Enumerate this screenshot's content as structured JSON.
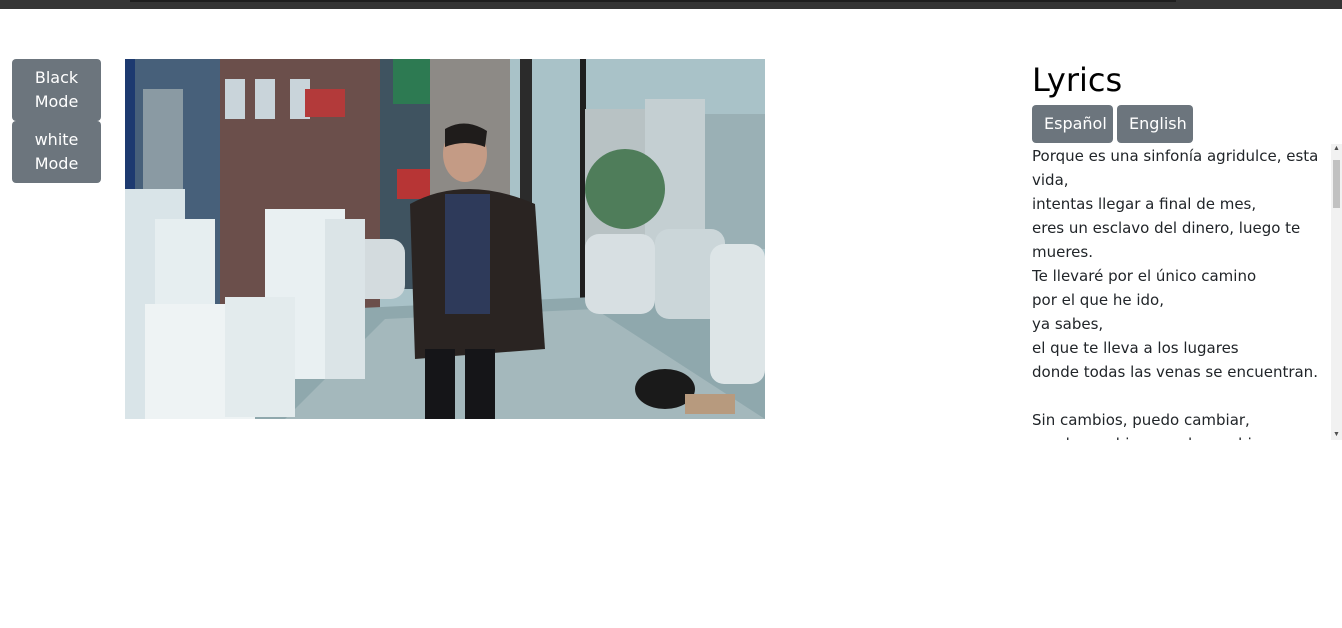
{
  "mode_buttons": {
    "black_label": "Black Mode",
    "white_label": "white Mode"
  },
  "lyrics": {
    "title": "Lyrics",
    "lang_es": "Español",
    "lang_en": "English",
    "text": "Porque es una sinfonía agridulce, esta vida,\nintentas llegar a final de mes,\neres un esclavo del dinero, luego te mueres.\nTe llevaré por el único camino\npor el que he ido,\nya sabes,\nel que te lleva a los lugares\ndonde todas las venas se encuentran.\n\nSin cambios, puedo cambiar,\npuedo cambiar, puedo cambiar"
  },
  "icons": {
    "scroll_up": "scroll-up-arrow-icon",
    "scroll_down": "scroll-down-arrow-icon"
  }
}
